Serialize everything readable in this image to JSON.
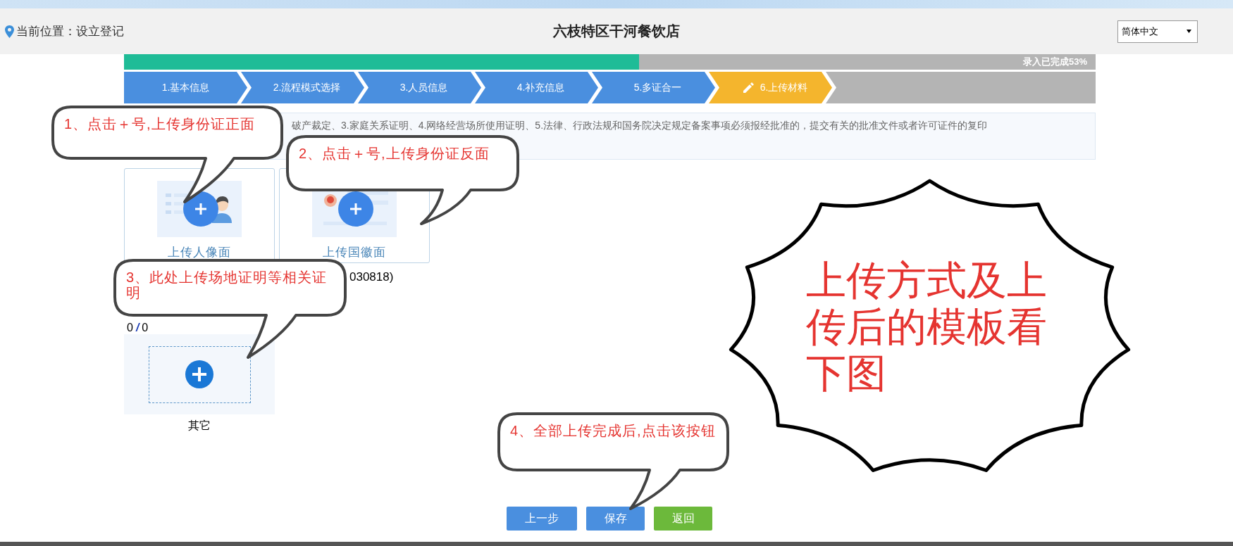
{
  "header": {
    "location": "当前位置：设立登记",
    "title": "六枝特区干河餐饮店",
    "language": "简体中文"
  },
  "progress": {
    "level": 0.53,
    "label": "录入已完成53%"
  },
  "steps": [
    {
      "label": "1.基本信息",
      "selected": false
    },
    {
      "label": "2.流程模式选择",
      "selected": false
    },
    {
      "label": "3.人员信息",
      "selected": false
    },
    {
      "label": "4.补充信息",
      "selected": false
    },
    {
      "label": "5.多证合一",
      "selected": false
    },
    {
      "label": "6.上传材料",
      "selected": true
    }
  ],
  "notice": "破产裁定、3.家庭关系证明、4.网络经营场所使用证明、5.法律、行政法规和国务院决定规定备案事项必须报经批准的，提交有关的批准文件或者许可证件的复印",
  "id_cards": [
    {
      "kind": "portrait",
      "label": "上传人像面"
    },
    {
      "kind": "emblem",
      "label": "上传国徽面"
    }
  ],
  "id_note": "030818)",
  "other": {
    "count": "0",
    "separator": "/",
    "total": "0",
    "label": "其它"
  },
  "buttons": [
    {
      "label": "上一步",
      "kind": "primary"
    },
    {
      "label": "保存",
      "kind": "primary"
    },
    {
      "label": "返回",
      "kind": "success"
    }
  ],
  "annotations": [
    {
      "kind": "bubble",
      "text": "1、点击＋号,上传身份证正面"
    },
    {
      "kind": "bubble",
      "text": "2、点击＋号,上传身份证反面"
    },
    {
      "kind": "bubble",
      "text": "3、此处上传场地证明等相关证明"
    },
    {
      "kind": "bubble",
      "text": "4、全部上传完成后,点击该按钮"
    },
    {
      "kind": "burst",
      "text": "上传方式及上传后的模板看下图"
    }
  ]
}
